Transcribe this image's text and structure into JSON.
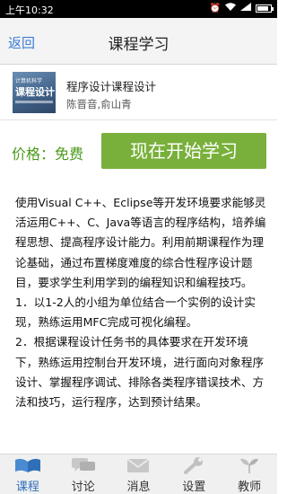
{
  "status_bar": {
    "time": "上午10:32",
    "battery_level": 0.85
  },
  "header": {
    "back_label": "返回",
    "title": "课程学习"
  },
  "course": {
    "name": "程序设计课程设计",
    "authors": "陈晋音,俞山青",
    "cover": {
      "line1": "计算机科学",
      "line2": "课程设计"
    }
  },
  "purchase": {
    "price_label": "价格：免费",
    "start_button": "现在开始学习"
  },
  "description": {
    "paragraphs": [
      "使用Visual C++、Eclipse等开发环境要求能够灵活运用C++、C、Java等语言的程序结构，培养编程思想、提高程序设计能力。利用前期课程作为理论基础，通过布置梯度难度的综合性程序设计题目，要求学生利用学到的编程知识和编程技巧。",
      "1．以1-2人的小组为单位结合一个实例的设计实现，熟练运用MFC完成可视化编程。",
      "2．根据课程设计任务书的具体要求在开发环境下，熟练运用控制台开发环境，进行面向对象程序设计、掌握程序调试、排除各类程序错误技术、方法和技巧，运行程序，达到预计结果。"
    ]
  },
  "tabs": [
    {
      "label": "课程",
      "icon": "book-icon",
      "active": true
    },
    {
      "label": "讨论",
      "icon": "chat-icon",
      "active": false
    },
    {
      "label": "消息",
      "icon": "envelope-icon",
      "active": false
    },
    {
      "label": "设置",
      "icon": "wrench-icon",
      "active": false
    },
    {
      "label": "教师",
      "icon": "sprout-icon",
      "active": false
    }
  ],
  "colors": {
    "accent_green": "#79b03b",
    "price_green": "#4a9a1a",
    "link_blue": "#3a7bd5",
    "tab_active": "#2f6fb8"
  }
}
